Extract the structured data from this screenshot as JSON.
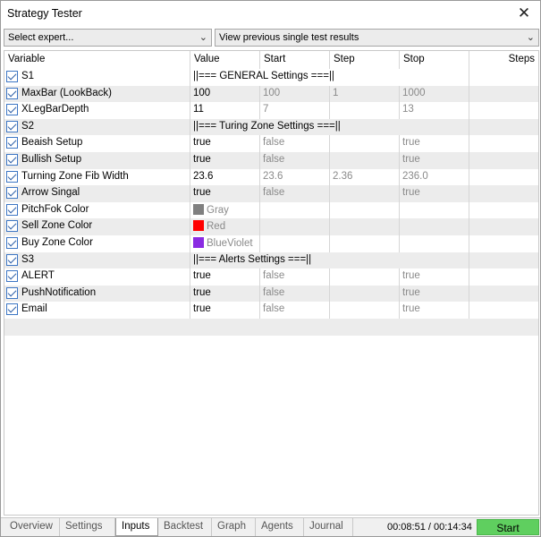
{
  "window": {
    "title": "Strategy Tester"
  },
  "toolbar": {
    "expert_select": "Select expert...",
    "mode_select": "View previous single test results"
  },
  "columns": [
    "Variable",
    "Value",
    "Start",
    "Step",
    "Stop",
    "Steps"
  ],
  "rows": [
    {
      "name": "S1",
      "value": "||=== GENERAL Settings ===||",
      "start": "",
      "step": "",
      "stop": "",
      "header": true
    },
    {
      "name": "MaxBar (LookBack)",
      "value": "100",
      "start": "100",
      "step": "1",
      "stop": "1000"
    },
    {
      "name": "XLegBarDepth",
      "value": "11",
      "start": "7",
      "step": "",
      "stop": "13"
    },
    {
      "name": "S2",
      "value": "||=== Turing Zone Settings ===||",
      "start": "",
      "step": "",
      "stop": "",
      "header": true
    },
    {
      "name": "Beaish Setup",
      "value": "true",
      "start": "false",
      "step": "",
      "stop": "true"
    },
    {
      "name": "Bullish Setup",
      "value": "true",
      "start": "false",
      "step": "",
      "stop": "true"
    },
    {
      "name": "Turning Zone Fib Width",
      "value": "23.6",
      "start": "23.6",
      "step": "2.36",
      "stop": "236.0"
    },
    {
      "name": "Arrow Singal",
      "value": "true",
      "start": "false",
      "step": "",
      "stop": "true"
    },
    {
      "name": "PitchFok Color",
      "value": "Gray",
      "color": "#808080",
      "start": "",
      "step": "",
      "stop": ""
    },
    {
      "name": "Sell Zone Color",
      "value": "Red",
      "color": "#ff0000",
      "start": "",
      "step": "",
      "stop": ""
    },
    {
      "name": "Buy Zone Color",
      "value": "BlueViolet",
      "color": "#8a2be2",
      "start": "",
      "step": "",
      "stop": ""
    },
    {
      "name": "S3",
      "value": "||=== Alerts Settings ===||",
      "start": "",
      "step": "",
      "stop": "",
      "header": true
    },
    {
      "name": "ALERT",
      "value": "true",
      "start": "false",
      "step": "",
      "stop": "true"
    },
    {
      "name": "PushNotification",
      "value": "true",
      "start": "false",
      "step": "",
      "stop": "true"
    },
    {
      "name": "Email",
      "value": "true",
      "start": "false",
      "step": "",
      "stop": "true"
    }
  ],
  "tabs": [
    "Overview",
    "Settings",
    "Inputs",
    "Backtest",
    "Graph",
    "Agents",
    "Journal"
  ],
  "active_tab": "Inputs",
  "timer": "00:08:51 / 00:14:34",
  "start_label": "Start",
  "accent_green": "#5fcf5f"
}
